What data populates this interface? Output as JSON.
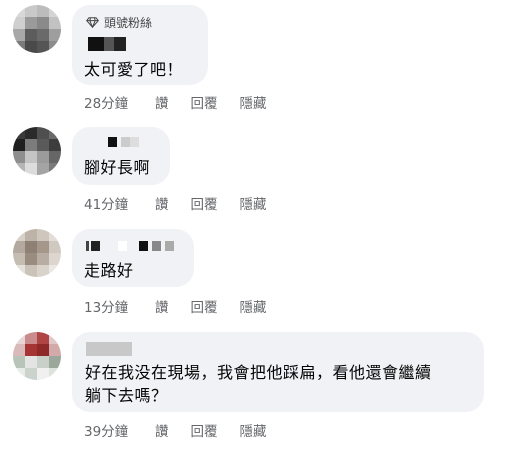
{
  "comments": [
    {
      "badge": "頭號粉絲",
      "text": "太可愛了吧！",
      "time": "28分鐘",
      "like": "讚",
      "reply": "回覆",
      "hide": "隱藏"
    },
    {
      "text": "腳好長啊",
      "time": "41分鐘",
      "like": "讚",
      "reply": "回覆",
      "hide": "隱藏"
    },
    {
      "text": "走路好",
      "time": "13分鐘",
      "like": "讚",
      "reply": "回覆",
      "hide": "隱藏"
    },
    {
      "text_line1": "好在我没在現場，我會把他踩扁，看他還會繼續",
      "text_line2": "躺下去嗎？",
      "time": "39分鐘",
      "like": "讚",
      "reply": "回覆",
      "hide": "隱藏"
    }
  ],
  "colors": {
    "bubble": "#f0f2f5",
    "meta_text": "#65676b",
    "body_text": "#050505"
  },
  "icons": {
    "top_fan_badge": "diamond-icon"
  }
}
